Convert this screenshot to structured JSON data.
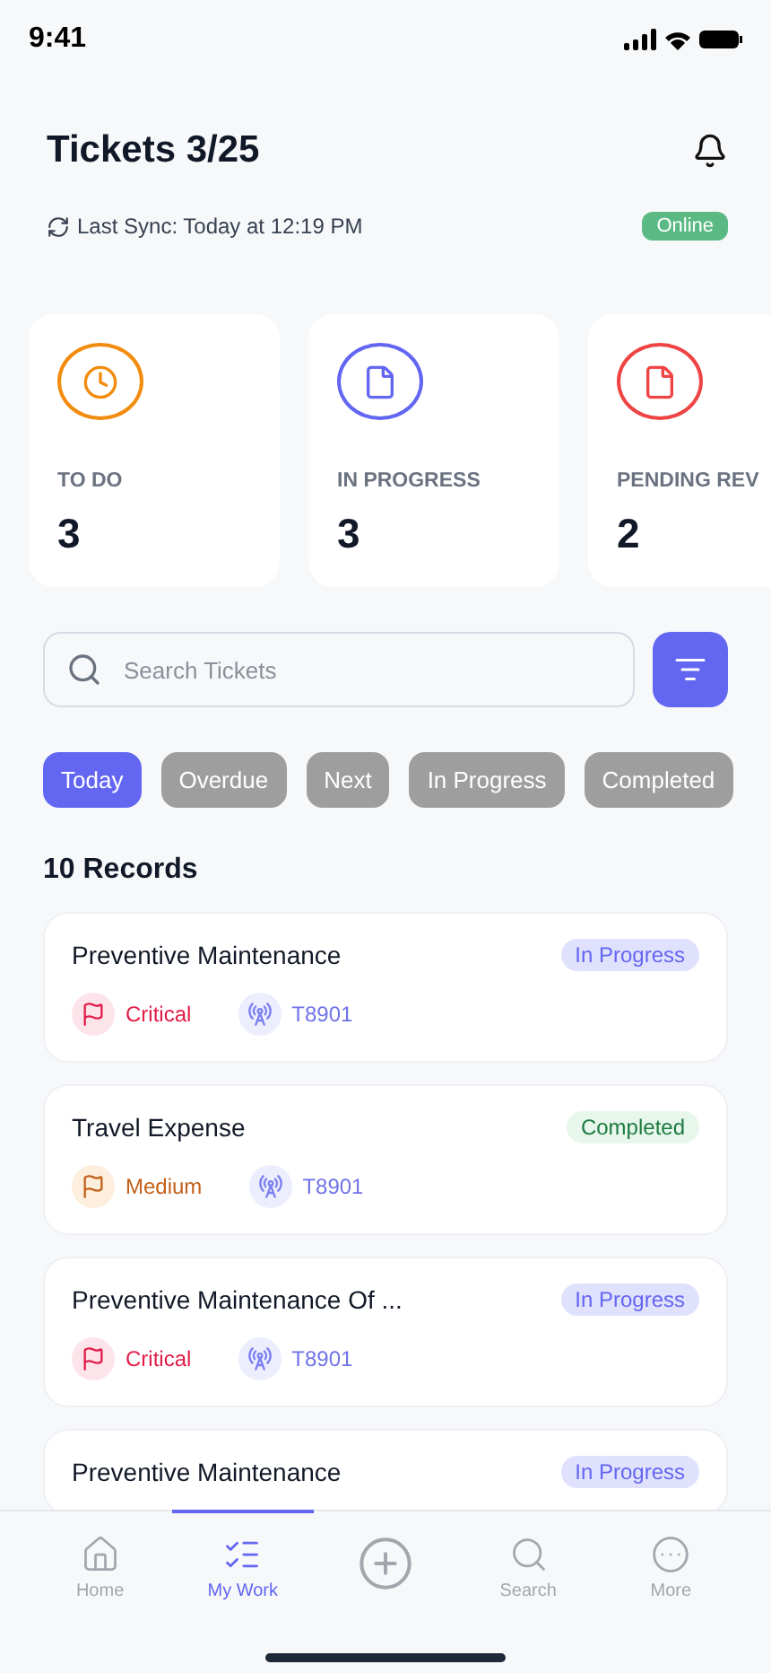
{
  "status_bar": {
    "time": "9:41"
  },
  "header": {
    "title": "Tickets 3/25",
    "sync": "Last Sync: Today at 12:19 PM",
    "connection": "Online"
  },
  "stats": [
    {
      "kind": "clock",
      "label": "TO DO",
      "count": "3",
      "color": "#f28c0f"
    },
    {
      "kind": "file",
      "label": "IN PROGRESS",
      "count": "3",
      "color": "#6366f1"
    },
    {
      "kind": "file",
      "label": "PENDING REV",
      "count": "2",
      "color": "#ef4444"
    }
  ],
  "search": {
    "placeholder": "Search Tickets"
  },
  "filters": [
    {
      "label": "Today",
      "selected": true
    },
    {
      "label": "Overdue",
      "selected": false
    },
    {
      "label": "Next",
      "selected": false
    },
    {
      "label": "In Progress",
      "selected": false
    },
    {
      "label": "Completed",
      "selected": false
    }
  ],
  "records_count": "10 Records",
  "tickets": [
    {
      "title": "Preventive Maintenance",
      "status": {
        "text": "In Progress",
        "kind": "in_progress"
      },
      "priority": {
        "text": "Critical",
        "kind": "critical"
      },
      "asset": "T8901"
    },
    {
      "title": "Travel Expense",
      "status": {
        "text": "Completed",
        "kind": "completed"
      },
      "priority": {
        "text": "Medium",
        "kind": "medium"
      },
      "asset": "T8901"
    },
    {
      "title": "Preventive Maintenance Of ...",
      "status": {
        "text": "In Progress",
        "kind": "in_progress"
      },
      "priority": {
        "text": "Critical",
        "kind": "critical"
      },
      "asset": "T8901"
    },
    {
      "title": "Preventive Maintenance",
      "status": {
        "text": "In Progress",
        "kind": "in_progress"
      }
    }
  ],
  "nav": [
    {
      "kind": "home",
      "label": "Home",
      "selected": false
    },
    {
      "kind": "list",
      "label": "My Work",
      "selected": true
    },
    {
      "kind": "add",
      "selected": false
    },
    {
      "kind": "search",
      "label": "Search",
      "selected": false
    },
    {
      "kind": "more",
      "label": "More",
      "selected": false
    }
  ]
}
